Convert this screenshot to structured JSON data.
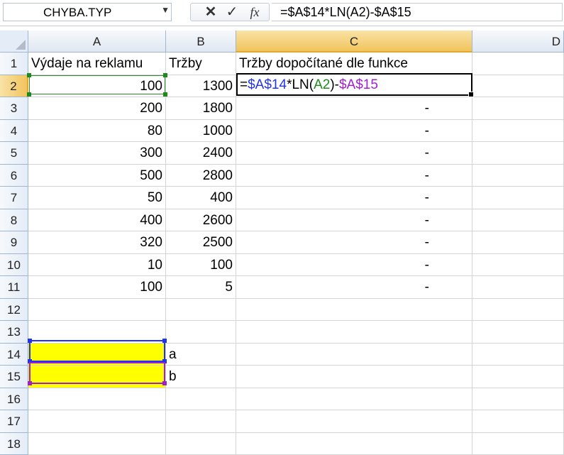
{
  "namebox": {
    "value": "CHYBA.TYP"
  },
  "formula_bar": {
    "cancel_icon": "✕",
    "enter_icon": "✓",
    "fx_label": "fx",
    "formula": "=$A$14*LN(A2)-$A$15"
  },
  "columns": [
    "A",
    "B",
    "C",
    "D"
  ],
  "rows": [
    "1",
    "2",
    "3",
    "4",
    "5",
    "6",
    "7",
    "8",
    "9",
    "10",
    "11",
    "12",
    "13",
    "14",
    "15",
    "16",
    "17",
    "18"
  ],
  "headers": {
    "a1": "Výdaje na reklamu",
    "b1": "Tržby",
    "c1": "Tržby dopočítané dle funkce"
  },
  "data_rows": [
    {
      "a": "100",
      "b": "1300",
      "c": ""
    },
    {
      "a": "200",
      "b": "1800",
      "c": "-"
    },
    {
      "a": "80",
      "b": "1000",
      "c": "-"
    },
    {
      "a": "300",
      "b": "2400",
      "c": "-"
    },
    {
      "a": "500",
      "b": "2800",
      "c": "-"
    },
    {
      "a": "50",
      "b": "400",
      "c": "-"
    },
    {
      "a": "400",
      "b": "2600",
      "c": "-"
    },
    {
      "a": "320",
      "b": "2500",
      "c": "-"
    },
    {
      "a": "10",
      "b": "100",
      "c": "-"
    },
    {
      "a": "100",
      "b": "5",
      "c": "-"
    }
  ],
  "edit_formula": {
    "eq": "=",
    "ref1": "$A$14",
    "mid1": "*LN(",
    "ref2": "A2",
    "mid2": ")-",
    "ref3": "$A$15"
  },
  "param_labels": {
    "b14": "a",
    "b15": "b"
  },
  "colors": {
    "ref_blue": "#2233ee",
    "ref_green": "#1e8a1e",
    "ref_purple": "#a020d0",
    "param_fill": "#ffff00"
  }
}
